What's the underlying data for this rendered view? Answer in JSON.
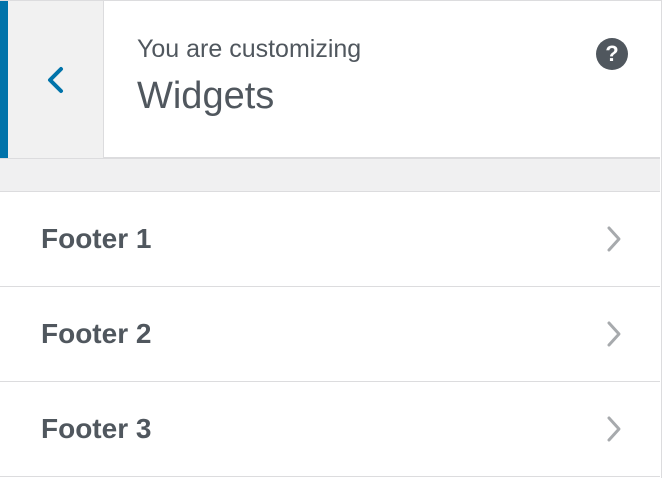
{
  "colors": {
    "accent": "#0073aa",
    "text": "#50575e",
    "back_bg": "#f1f1f1",
    "chevron": "#a7aaad"
  },
  "header": {
    "subtitle": "You are customizing",
    "title": "Widgets",
    "back_icon": "chevron-left-icon",
    "help_icon": "help-icon",
    "help_glyph": "?"
  },
  "sections": [
    {
      "label": "Footer 1",
      "icon": "chevron-right-icon"
    },
    {
      "label": "Footer 2",
      "icon": "chevron-right-icon"
    },
    {
      "label": "Footer 3",
      "icon": "chevron-right-icon"
    }
  ]
}
